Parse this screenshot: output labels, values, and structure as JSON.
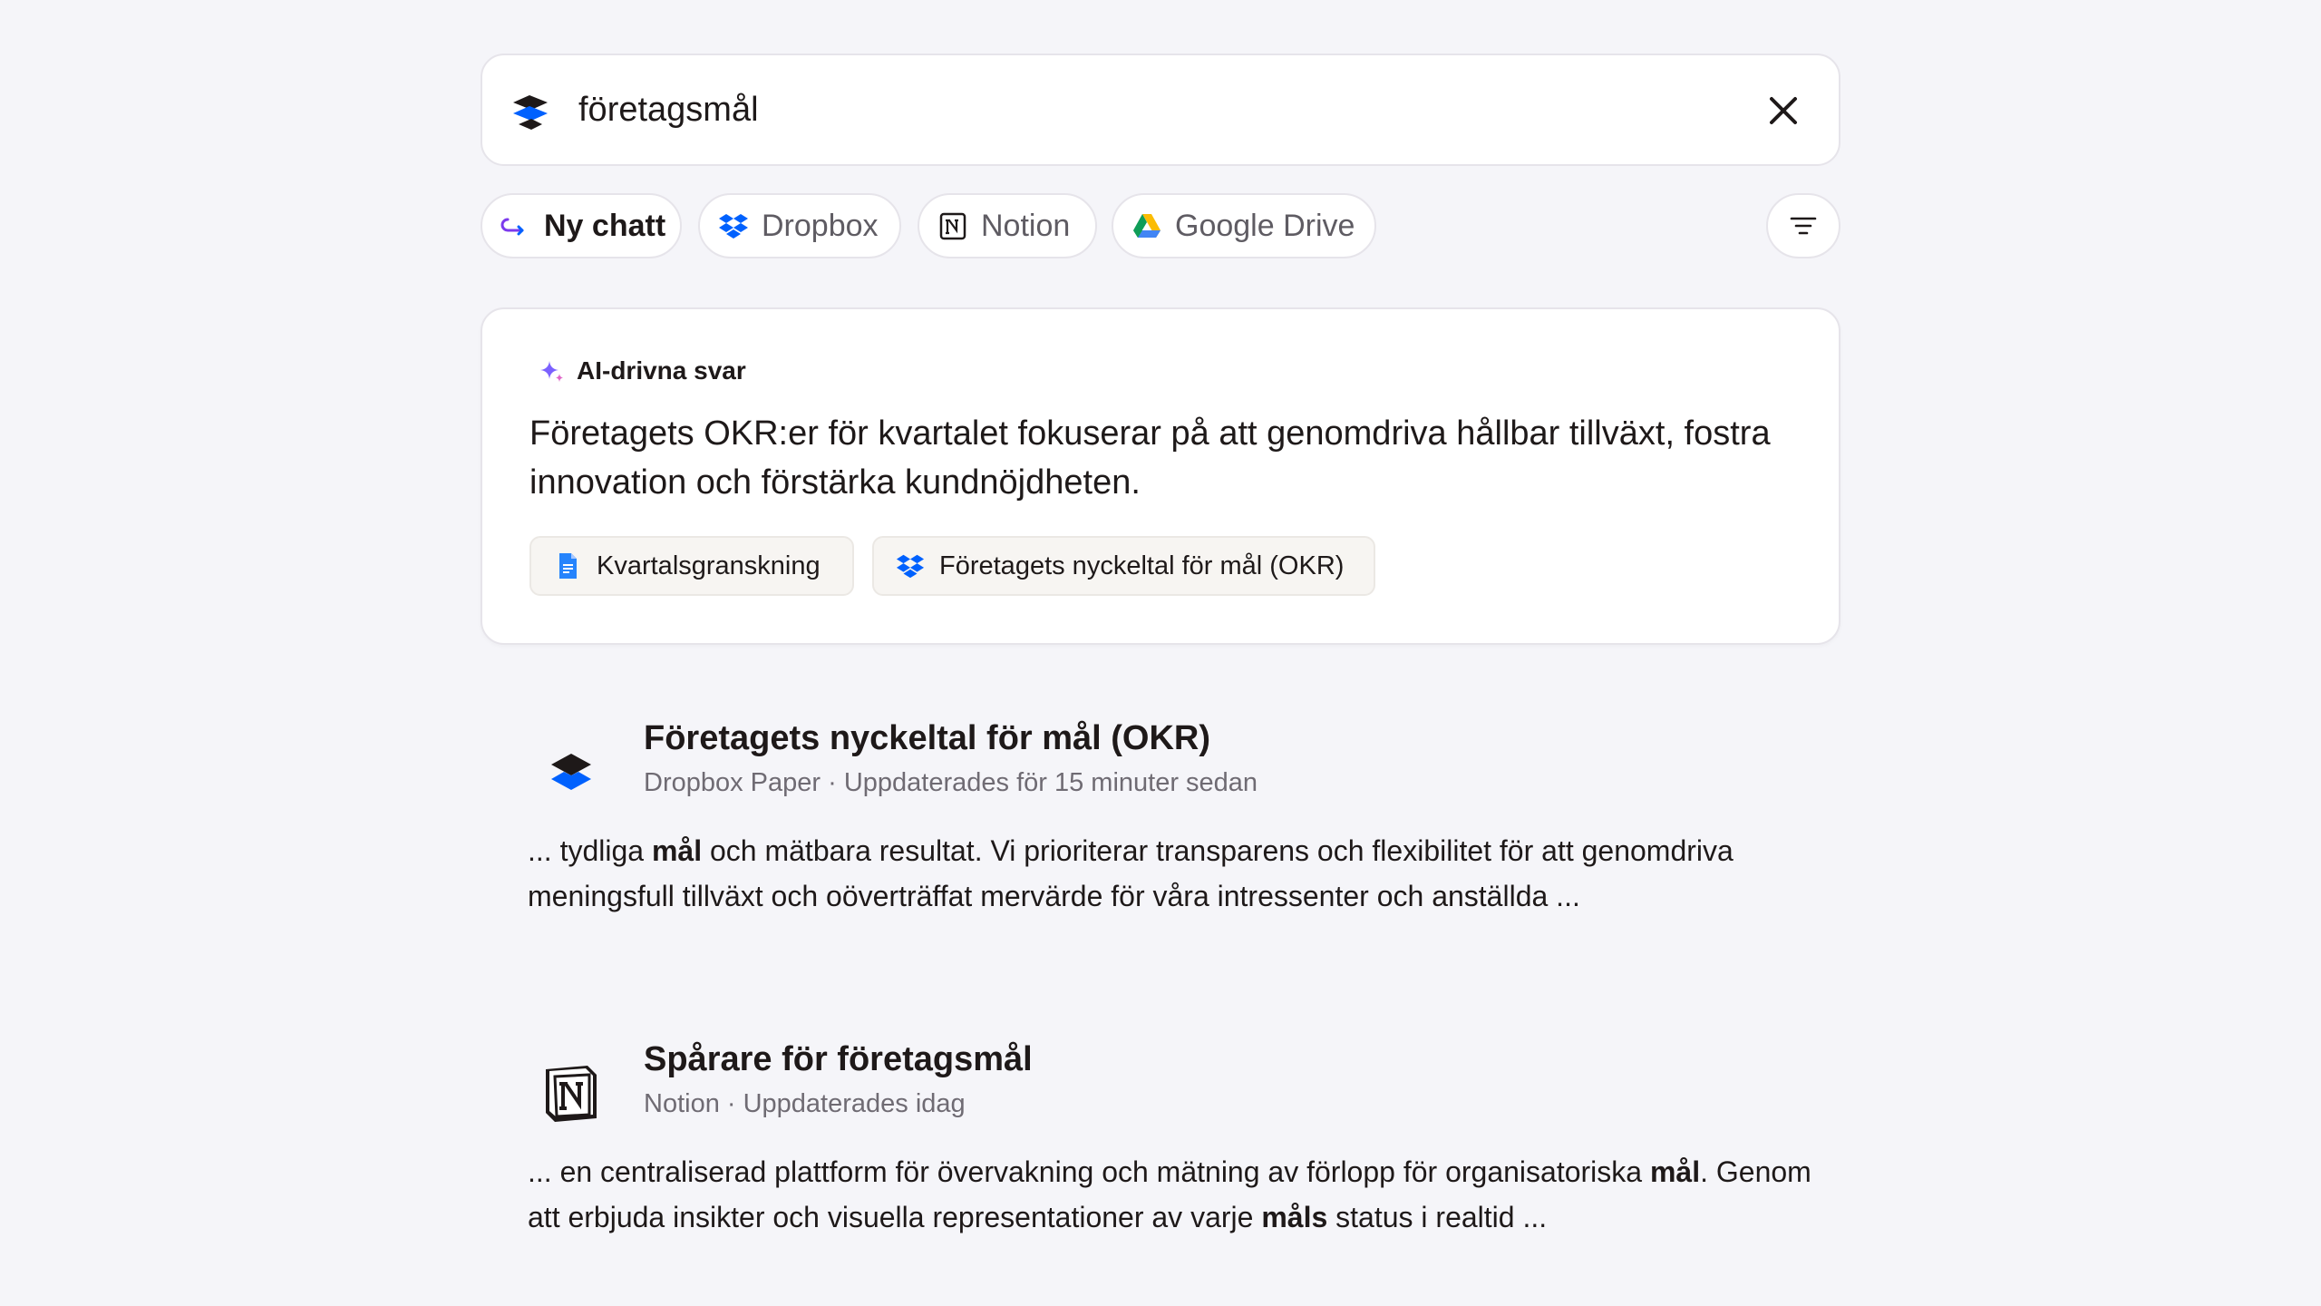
{
  "search": {
    "query": "företagsmål",
    "logo_icon": "dropbox-dash-logo-icon",
    "clear_icon": "close-icon"
  },
  "chips": [
    {
      "label": "Ny chatt",
      "icon": "chat-arrow-icon",
      "active": true
    },
    {
      "label": "Dropbox",
      "icon": "dropbox-icon",
      "active": false
    },
    {
      "label": "Notion",
      "icon": "notion-icon",
      "active": false
    },
    {
      "label": "Google Drive",
      "icon": "google-drive-icon",
      "active": false
    }
  ],
  "filter": {
    "icon": "filter-icon"
  },
  "ai_card": {
    "header": "AI-drivna svar",
    "answer": "Företagets OKR:er för kvartalet fokuserar på att genomdriva hållbar tillväxt, fostra innovation och förstärka kundnöjdheten.",
    "sources": [
      {
        "label": "Kvartalsgranskning",
        "icon": "google-docs-icon"
      },
      {
        "label": "Företagets nyckeltal för mål (OKR)",
        "icon": "dropbox-icon"
      }
    ]
  },
  "results": [
    {
      "title": "Företagets nyckeltal för mål (OKR)",
      "meta": "Dropbox Paper · Uppdaterades för 15 minuter sedan",
      "icon": "dropbox-paper-icon",
      "snippet_parts": [
        "... tydliga ",
        "mål",
        " och mätbara resultat. Vi prioriterar transparens och flexibilitet för att genomdriva meningsfull tillväxt och oöverträffat mervärde för våra intressenter och anställda ..."
      ]
    },
    {
      "title": "Spårare för företagsmål",
      "meta": "Notion · Uppdaterades idag",
      "icon": "notion-icon",
      "snippet_parts": [
        "... en centraliserad plattform för övervakning och mätning av förlopp för organisatoriska ",
        "mål",
        ". Genom att erbjuda insikter och visuella representationer av varje ",
        "måls",
        " status i realtid ..."
      ]
    }
  ],
  "colors": {
    "background": "#f5f5f9",
    "dropbox_blue": "#0061fe",
    "text": "#1e1919",
    "muted": "#6f6b73"
  }
}
